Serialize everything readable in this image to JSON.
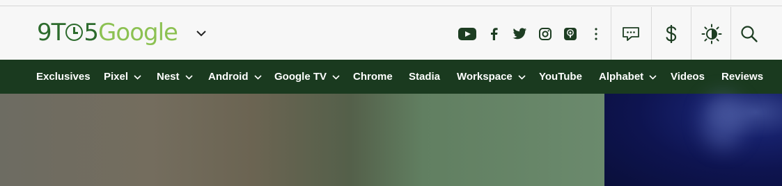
{
  "brand": {
    "logo_part1": "9T",
    "logo_part2": "5",
    "logo_part3": "Google",
    "logo_alt": "9TO5Google",
    "colors": {
      "dark_green": "#2d6b2d",
      "light_green": "#8cc152",
      "nav_bg": "#1a3a1f"
    }
  },
  "social": [
    {
      "name": "youtube-icon"
    },
    {
      "name": "facebook-icon"
    },
    {
      "name": "twitter-icon"
    },
    {
      "name": "instagram-icon"
    },
    {
      "name": "podcast-icon"
    },
    {
      "name": "more-vertical-icon"
    }
  ],
  "tools": [
    {
      "name": "comments-icon"
    },
    {
      "name": "dollar-icon"
    },
    {
      "name": "theme-toggle-icon"
    },
    {
      "name": "search-icon"
    }
  ],
  "nav": {
    "items": [
      {
        "label": "Exclusives",
        "has_dropdown": false
      },
      {
        "label": "Pixel",
        "has_dropdown": true
      },
      {
        "label": "Nest",
        "has_dropdown": true
      },
      {
        "label": "Android",
        "has_dropdown": true
      },
      {
        "label": "Google TV",
        "has_dropdown": true
      },
      {
        "label": "Chrome",
        "has_dropdown": false
      },
      {
        "label": "Stadia",
        "has_dropdown": false
      },
      {
        "label": "Workspace",
        "has_dropdown": true
      },
      {
        "label": "YouTube",
        "has_dropdown": false
      },
      {
        "label": "Alphabet",
        "has_dropdown": true
      },
      {
        "label": "Videos",
        "has_dropdown": false
      },
      {
        "label": "Reviews",
        "has_dropdown": false
      }
    ]
  }
}
